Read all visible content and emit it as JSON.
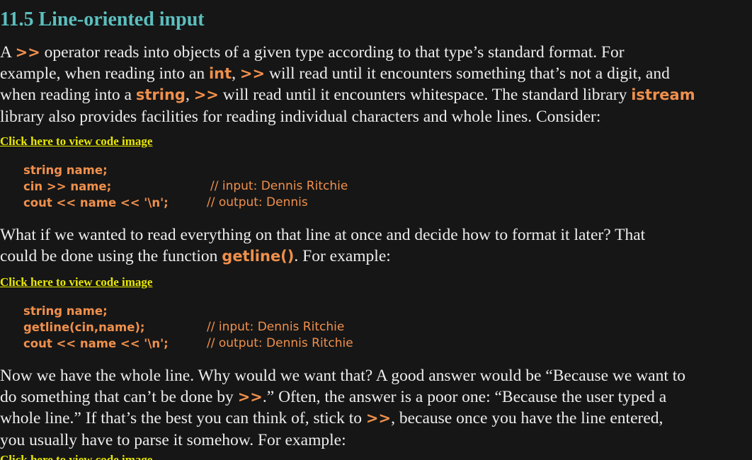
{
  "section": {
    "heading": "11.5 Line-oriented input"
  },
  "para1": {
    "l1_a": "A ",
    "l1_code1": ">>",
    "l1_b": " operator reads into objects of a given type according to that type’s standard format. For",
    "l2_a": "example, when reading into an ",
    "l2_code1": "int",
    "l2_b": ", ",
    "l2_code2": ">>",
    "l2_c": " will read until it encounters something that’s not a digit, and",
    "l3_a": "when reading into a ",
    "l3_code1": "string",
    "l3_b": ", ",
    "l3_code2": ">>",
    "l3_c": " will read until it encounters whitespace. The standard library ",
    "l3_code3": "istream",
    "l4": "library also provides facilities for reading individual characters and whole lines. Consider:"
  },
  "link1": "Click here to view code image",
  "code1": [
    {
      "code": "string name;",
      "comment": ""
    },
    {
      "code": "cin >> name;",
      "comment": "// input: Dennis Ritchie"
    },
    {
      "code": "cout << name << '\\n';",
      "comment": "// output: Dennis"
    }
  ],
  "para2": {
    "l1": "What if we wanted to read everything on that line at once and decide how to format it later? That",
    "l2_a": "could be done using the function ",
    "l2_code1": "getline()",
    "l2_b": ". For example:"
  },
  "link2": "Click here to view code image",
  "code2": [
    {
      "code": "string name;",
      "comment": ""
    },
    {
      "code": "getline(cin,name);",
      "comment": "// input: Dennis Ritchie"
    },
    {
      "code": "cout << name << '\\n';",
      "comment": "// output: Dennis Ritchie"
    }
  ],
  "para3": {
    "l1": "Now we have the whole line. Why would we want that? A good answer would be “Because we want to",
    "l2_a": "do something that can’t be done by ",
    "l2_code1": ">>",
    "l2_b": ".” Often, the answer is a poor one: “Because the user typed a",
    "l3_a": "whole line.” If that’s the best you can think of, stick to ",
    "l3_code1": ">>",
    "l3_b": ", because once you have the line entered,",
    "l4": "you usually have to parse it somehow. For example:"
  },
  "link3": "Click here to view code image",
  "colors": {
    "background": "#161616",
    "heading": "#5cbfbf",
    "body_text": "#ededed",
    "code": "#f0904c",
    "link": "#e8e800"
  }
}
